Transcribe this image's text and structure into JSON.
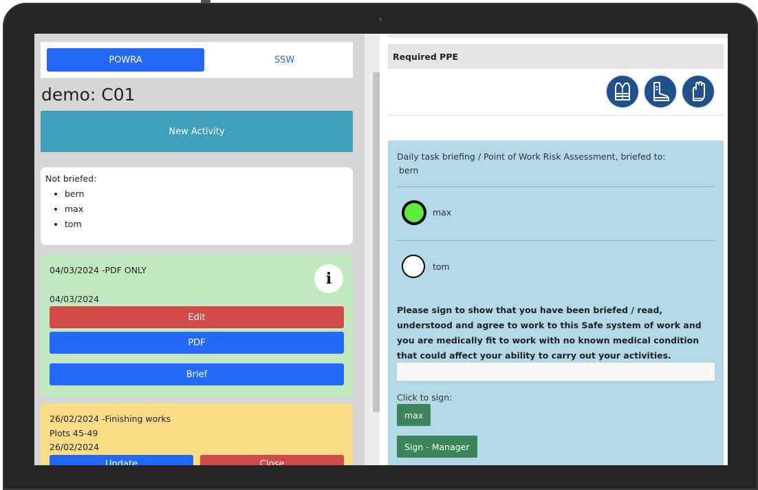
{
  "tabs": {
    "powra": "POWRA",
    "ssw": "SSW"
  },
  "site_title": "demo: C01",
  "new_activity_label": "New Activity",
  "not_briefed": {
    "label": "Not briefed:",
    "people": [
      "bern",
      "max",
      "tom"
    ]
  },
  "activities": [
    {
      "title": "04/03/2024 -PDF ONLY",
      "date": "04/03/2024",
      "info_label": "i",
      "edit_label": "Edit",
      "pdf_label": "PDF",
      "brief_label": "Brief"
    },
    {
      "title": "26/02/2024 -Finishing works",
      "subtitle": "Plots 45-49",
      "date": "26/02/2024",
      "update_label": "Update",
      "close_label": "Close"
    }
  ],
  "ppe": {
    "heading": "Required PPE",
    "icons": [
      "hi-vis-vest-icon",
      "safety-boots-icon",
      "gloves-icon"
    ]
  },
  "briefing": {
    "heading": "Daily task briefing / Point of Work Risk Assessment, briefed to:",
    "briefed_to": "bern",
    "people": [
      {
        "name": "max",
        "signed": true
      },
      {
        "name": "tom",
        "signed": false
      }
    ],
    "declaration": "Please sign to show that you have been briefed / read, understood and agree to work to this Safe system of work and you are medically fit to work with no known medical condition that could affect your ability to carry out your activities.",
    "click_to_sign": "Click to sign:",
    "sign_person_label": "max",
    "sign_manager_label": "Sign - Manager"
  },
  "colors": {
    "primary_blue": "#2468f7",
    "teal": "#41a0b9",
    "danger_red": "#d04a4a",
    "success_green": "#3b8658",
    "signed_green": "#5cec3e",
    "card_green": "#c1e8bf",
    "card_yellow": "#fbdc86",
    "panel_blue": "#b3d8e8",
    "ppe_navy": "#21518a"
  }
}
